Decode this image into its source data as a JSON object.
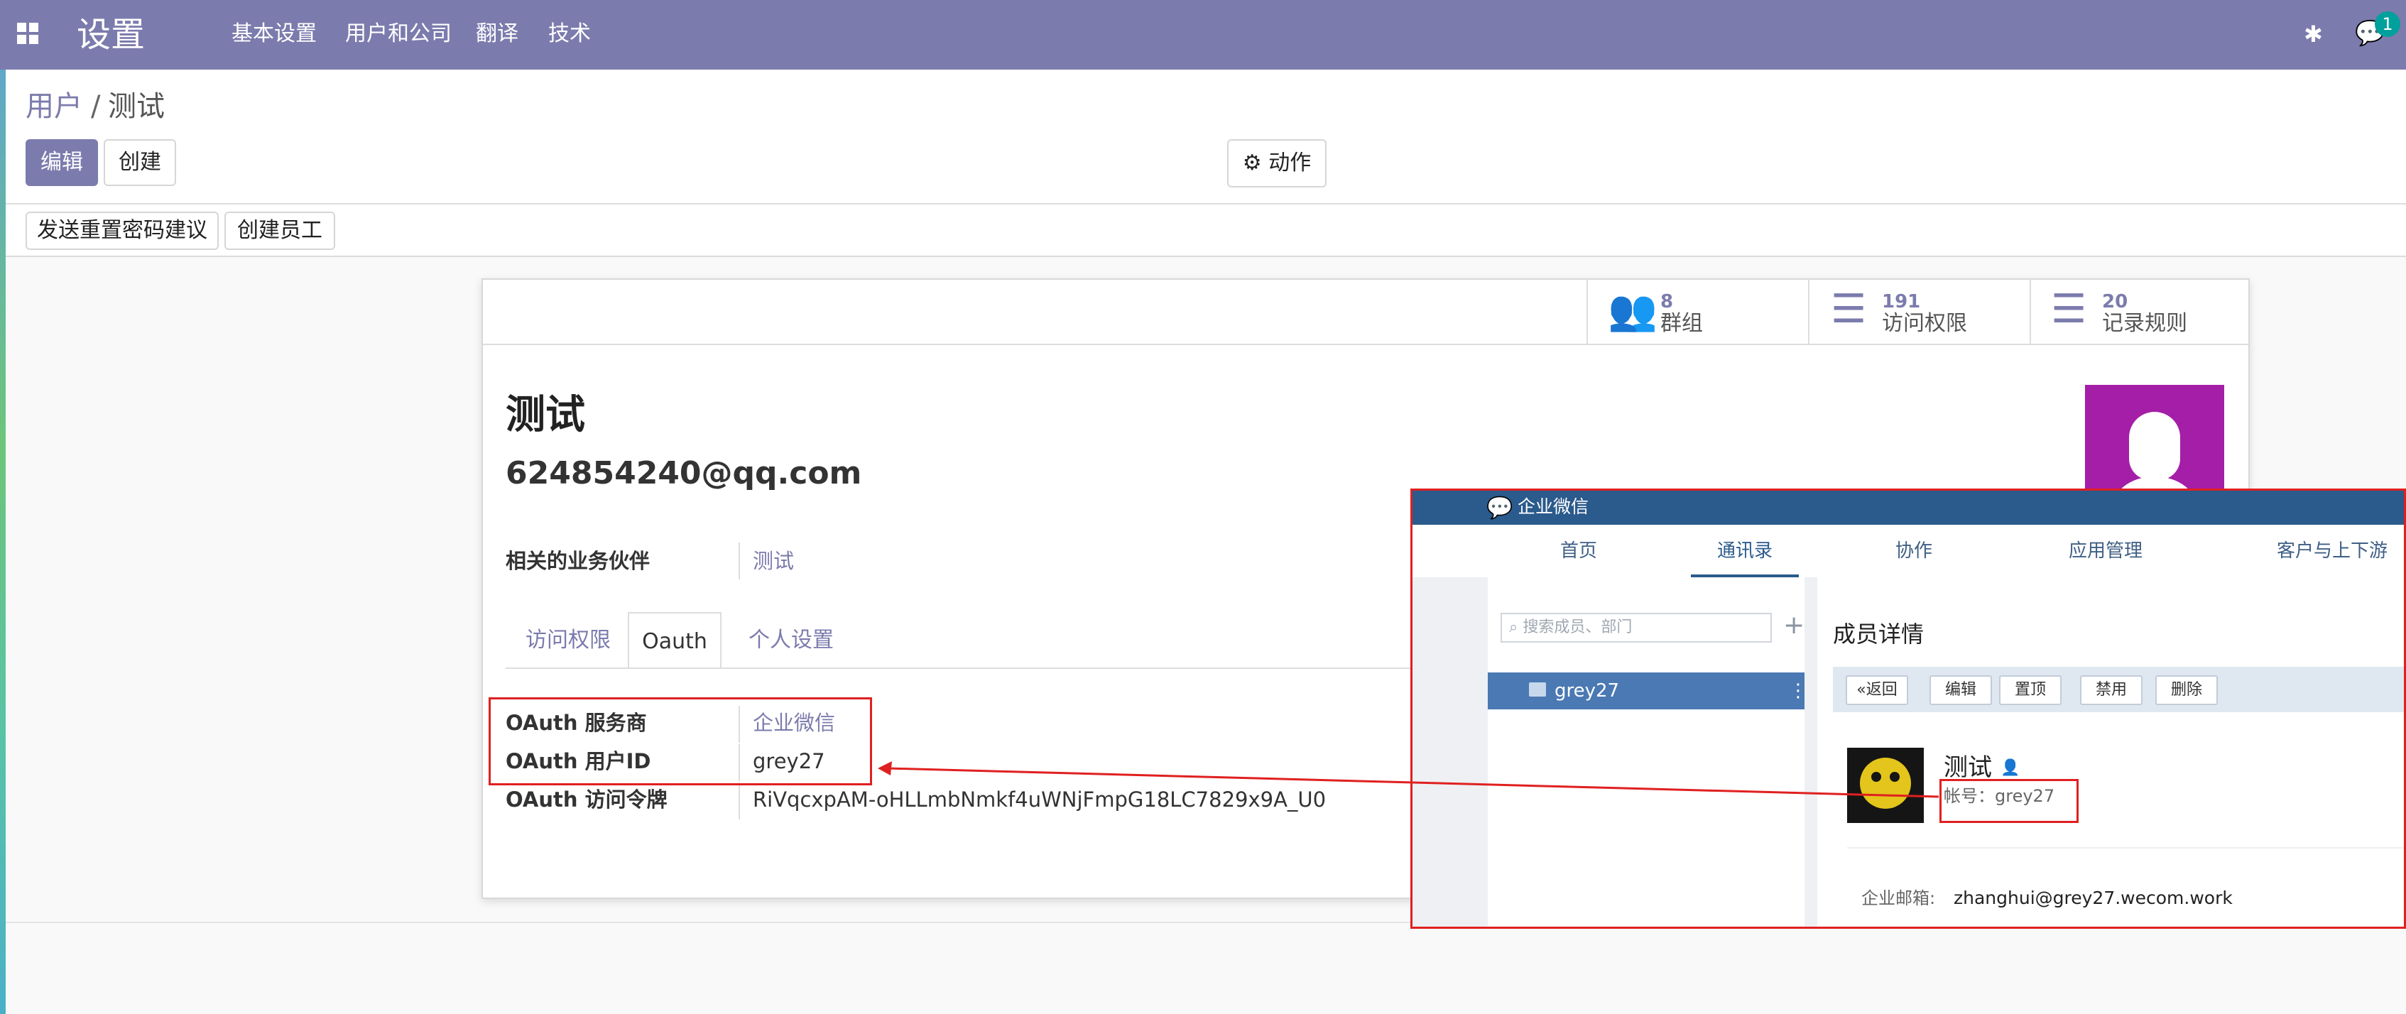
{
  "navbar": {
    "app_title": "设置",
    "menu": [
      "基本设置",
      "用户和公司",
      "翻译",
      "技术"
    ],
    "bug_icon": "bug-icon",
    "chat_badge": "1",
    "accent": "#7c7bad"
  },
  "breadcrumb": {
    "parent": "用户",
    "separator": "/",
    "current": "测试"
  },
  "buttons": {
    "edit": "编辑",
    "create": "创建",
    "action": "动作"
  },
  "header_buttons": {
    "reset_password": "发送重置密码建议",
    "create_employee": "创建员工"
  },
  "stat_buttons": [
    {
      "count": "8",
      "label": "群组",
      "icon": "users-icon"
    },
    {
      "count": "191",
      "label": "访问权限",
      "icon": "list-icon"
    },
    {
      "count": "20",
      "label": "记录规则",
      "icon": "list-icon"
    }
  ],
  "user": {
    "name": "测试",
    "email": "624854240@qq.com",
    "avatar_color": "#a41ea8"
  },
  "partner": {
    "label": "相关的业务伙伴",
    "value": "测试"
  },
  "tabs": [
    "访问权限",
    "Oauth",
    "个人设置"
  ],
  "active_tab": "Oauth",
  "oauth": {
    "provider_label": "OAuth 服务商",
    "provider_value": "企业微信",
    "uid_label": "OAuth 用户ID",
    "uid_value": "grey27",
    "token_label": "OAuth 访问令牌",
    "token_value": "RiVqcxpAM-oHLLmbNmkf4uWNjFmpG18LC7829x9A_U0"
  },
  "wecom": {
    "logo": "企业微信",
    "nav": [
      "首页",
      "通讯录",
      "协作",
      "应用管理",
      "客户与上下游"
    ],
    "active_nav": "通讯录",
    "search_placeholder": "搜索成员、部门",
    "plus": "+",
    "selected_dept": "grey27",
    "panel_title": "成员详情",
    "back": "返回",
    "toolbar": [
      "编辑",
      "置顶",
      "禁用",
      "删除"
    ],
    "member_name": "测试",
    "account_label": "帐号：",
    "account_value": "grey27",
    "email_label": "企业邮箱:",
    "email_value": "zhanghui@grey27.wecom.work",
    "theme_color": "#2b5a8c"
  },
  "annotation_color": "#e02020"
}
